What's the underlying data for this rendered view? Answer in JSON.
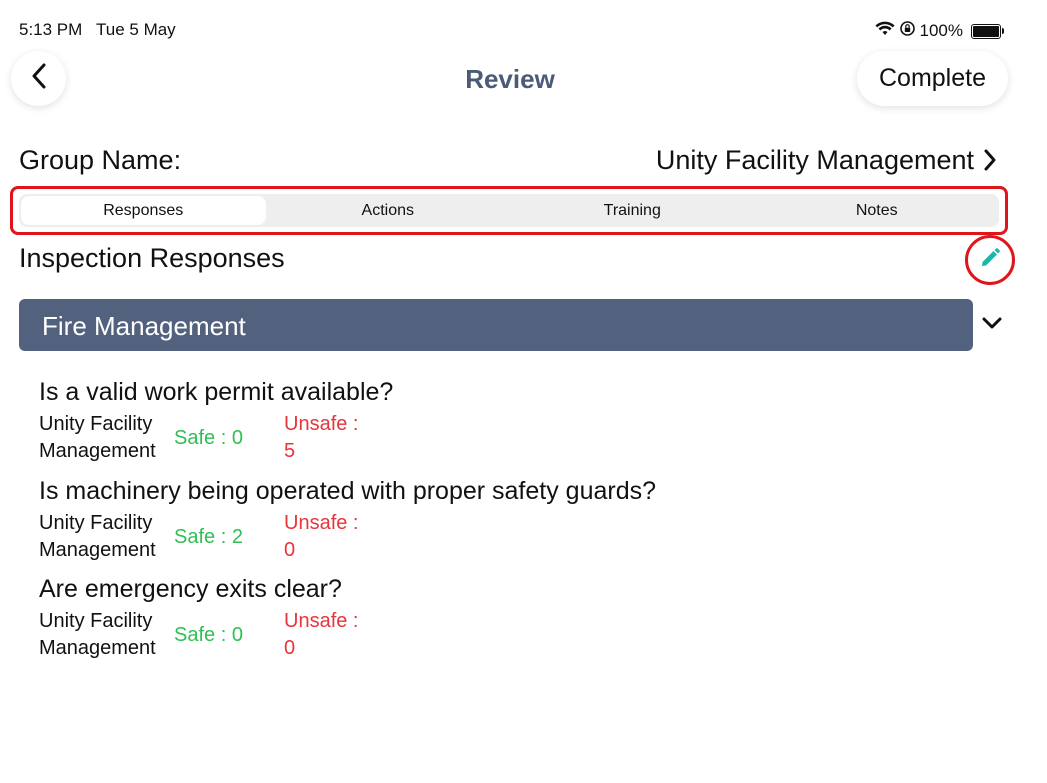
{
  "status": {
    "time": "5:13 PM",
    "date": "Tue 5 May",
    "battery": "100%"
  },
  "nav": {
    "title": "Review",
    "complete_label": "Complete"
  },
  "group": {
    "label": "Group Name:",
    "value": "Unity Facility Management"
  },
  "tabs": [
    {
      "label": "Responses",
      "active": true
    },
    {
      "label": "Actions",
      "active": false
    },
    {
      "label": "Training",
      "active": false
    },
    {
      "label": "Notes",
      "active": false
    }
  ],
  "section": {
    "title": "Inspection Responses"
  },
  "category": {
    "label": "Fire Management"
  },
  "questions": [
    {
      "text": "Is a valid work permit available?",
      "group_line1": "Unity Facility",
      "group_line2": "Management",
      "safe": "Safe  : 0",
      "unsafe_line1": "Unsafe  :",
      "unsafe_line2": "5"
    },
    {
      "text": "Is machinery being operated with proper safety guards?",
      "group_line1": "Unity Facility",
      "group_line2": "Management",
      "safe": "Safe  : 2",
      "unsafe_line1": "Unsafe  :",
      "unsafe_line2": "0"
    },
    {
      "text": "Are emergency exits clear?",
      "group_line1": "Unity Facility",
      "group_line2": "Management",
      "safe": "Safe  : 0",
      "unsafe_line1": "Unsafe  :",
      "unsafe_line2": "0"
    }
  ],
  "colors": {
    "title": "#4a5a78",
    "category_bg": "#52627e",
    "safe": "#2fbf55",
    "unsafe": "#e8343b",
    "highlight": "#e0151b",
    "edit_icon": "#1fb5a8"
  }
}
